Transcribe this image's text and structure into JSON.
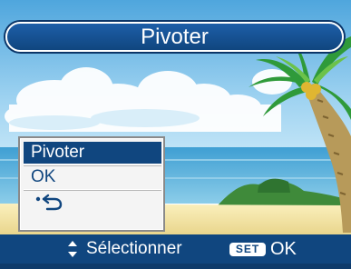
{
  "screen": {
    "title": "Pivoter",
    "menu": {
      "items": [
        {
          "label": "Pivoter",
          "selected": true
        },
        {
          "label": "OK",
          "selected": false
        },
        {
          "label": "",
          "icon": "rotate-back-arrow-icon",
          "selected": false
        }
      ]
    },
    "footer": {
      "navigate_icon": "up-down-arrows-icon",
      "select_label": "Sélectionner",
      "set_badge": "SET",
      "ok_label": "OK"
    }
  },
  "colors": {
    "bar_blue": "#10467f",
    "sky_blue": "#8fc8ec",
    "sea_blue": "#5aaed8",
    "sand": "#f4e8a8",
    "highlight": "#10467f",
    "text_white": "#ffffff"
  }
}
